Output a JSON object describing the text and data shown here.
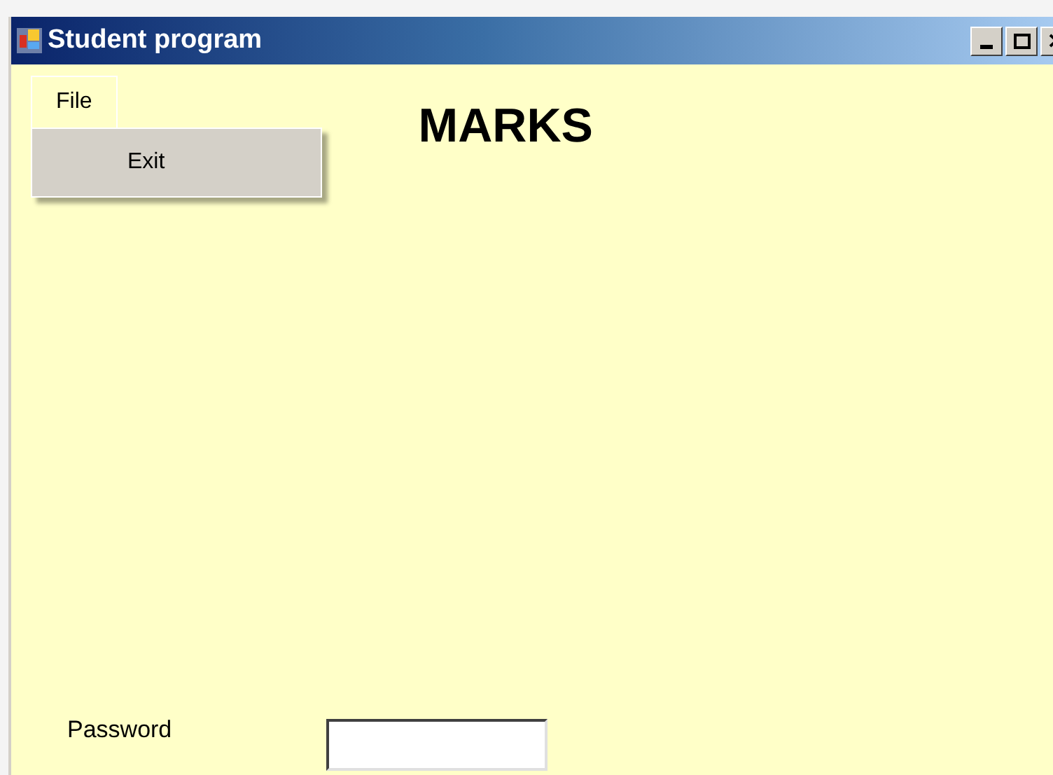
{
  "window": {
    "title": "Student program"
  },
  "menu": [
    {
      "label": "File",
      "expanded": true,
      "items": [
        {
          "label": "Exit"
        }
      ]
    }
  ],
  "heading": "MARKS",
  "password": {
    "label": "Password"
  }
}
